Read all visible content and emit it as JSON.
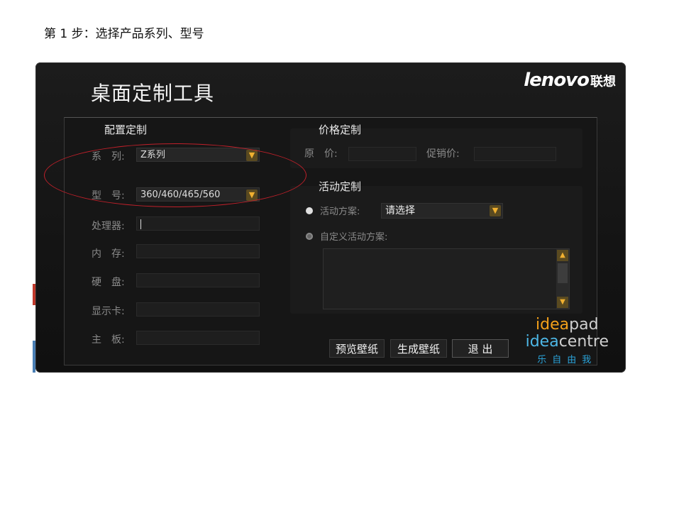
{
  "step_caption": "第 1 步：选择产品系列、型号",
  "window": {
    "title": "桌面定制工具",
    "brand_latin": "lenovo",
    "brand_cn": "联想"
  },
  "config": {
    "section_title": "配置定制",
    "series_label": "系　列:",
    "series_value": "Z系列",
    "model_label": "型　号:",
    "model_value": "360/460/465/560",
    "cpu_label": "处理器:",
    "cpu_value": "",
    "memory_label": "内　存:",
    "memory_value": "",
    "disk_label": "硬　盘:",
    "disk_value": "",
    "gpu_label": "显示卡:",
    "gpu_value": "",
    "board_label": "主　板:",
    "board_value": ""
  },
  "price": {
    "section_title": "价格定制",
    "original_label": "原　价:",
    "original_value": "",
    "promo_label": "促销价:",
    "promo_value": ""
  },
  "activity": {
    "section_title": "活动定制",
    "plan_label": "活动方案:",
    "plan_value": "请选择",
    "custom_label": "自定义活动方案:",
    "custom_text": ""
  },
  "buttons": {
    "preview": "预览壁纸",
    "generate": "生成壁纸",
    "exit": "退 出"
  },
  "logo": {
    "line1_a": "idea",
    "line1_b": "pad",
    "line2_a": "idea",
    "line2_b": "centre",
    "slogan": "乐自由我"
  },
  "colors": {
    "accent_orange": "#f3a01a",
    "accent_blue": "#4db7e6",
    "highlight_red": "#c0202a"
  }
}
